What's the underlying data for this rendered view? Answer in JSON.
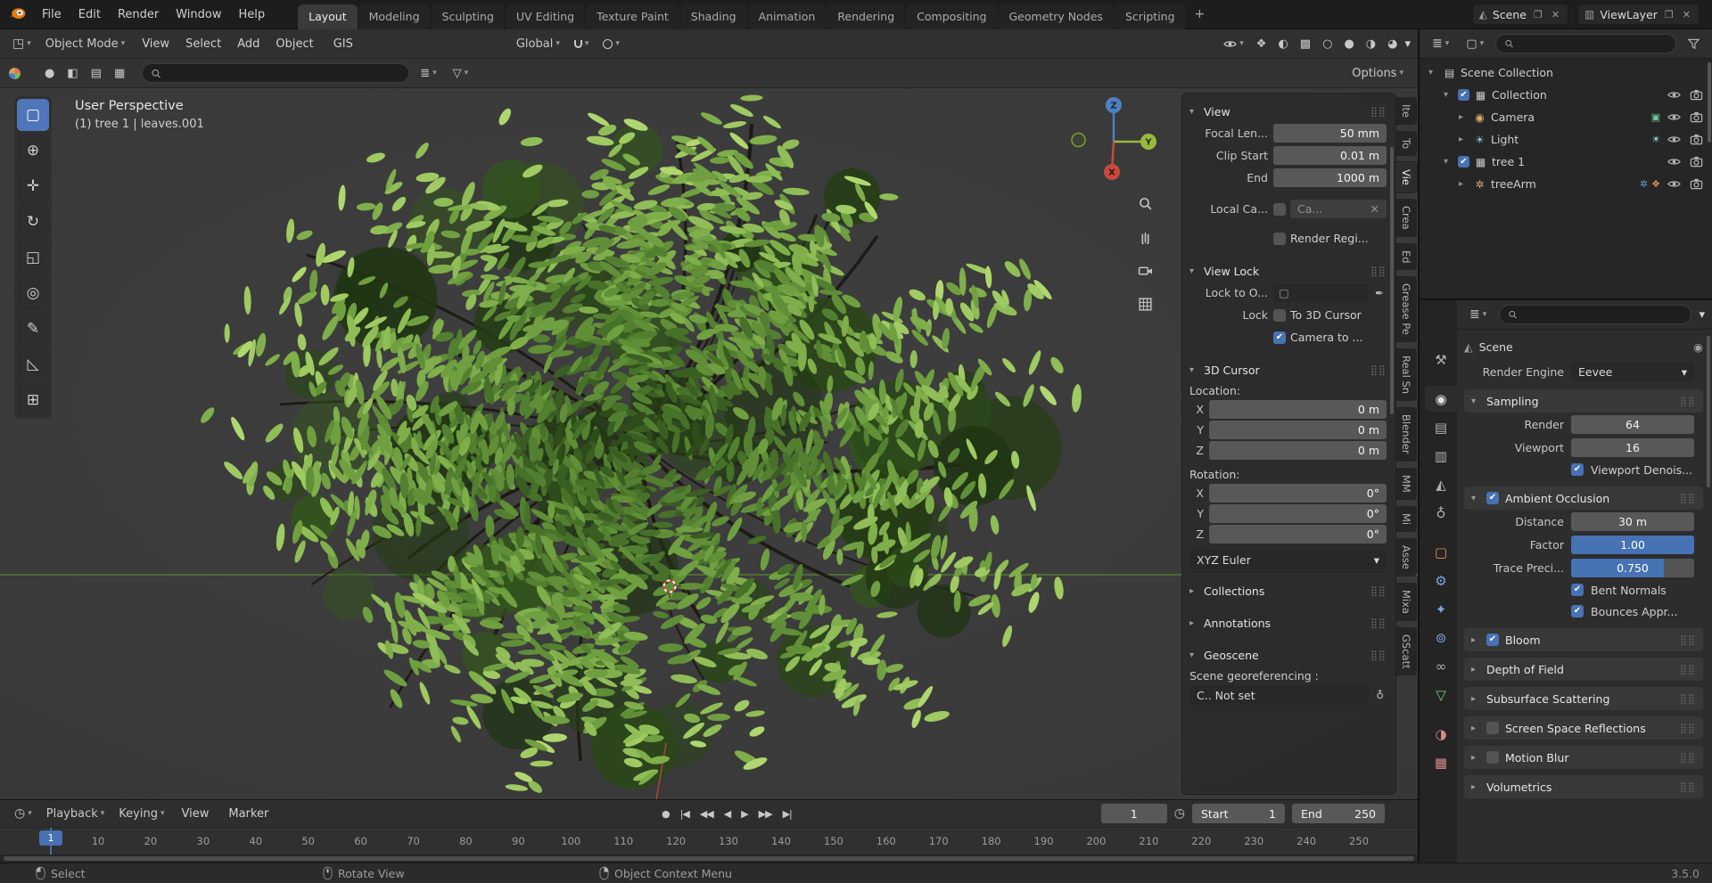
{
  "topbar": {
    "menus": [
      "File",
      "Edit",
      "Render",
      "Window",
      "Help"
    ],
    "workspaces": [
      {
        "label": "Layout",
        "active": true
      },
      {
        "label": "Modeling"
      },
      {
        "label": "Sculpting"
      },
      {
        "label": "UV Editing"
      },
      {
        "label": "Texture Paint"
      },
      {
        "label": "Shading"
      },
      {
        "label": "Animation"
      },
      {
        "label": "Rendering"
      },
      {
        "label": "Compositing"
      },
      {
        "label": "Geometry Nodes"
      },
      {
        "label": "Scripting"
      }
    ],
    "add_tab": "+",
    "scene_label": "Scene",
    "viewlayer_label": "ViewLayer",
    "scene_icon": "◭",
    "viewlayer_icon": "▥",
    "new_button": "❐",
    "unlink_button": "✕"
  },
  "viewport_header": {
    "editor_icon": "◳",
    "mode": "Object Mode",
    "menus": [
      "View",
      "Select",
      "Add",
      "Object"
    ],
    "gis_menu": "GIS",
    "orientation": "Global",
    "right_icons": [
      {
        "name": "show-gizmo",
        "glyph": "❖"
      },
      {
        "name": "overlays",
        "glyph": "◐"
      },
      {
        "name": "toggle-xray",
        "glyph": "▩"
      },
      {
        "name": "shading-wireframe",
        "glyph": "○"
      },
      {
        "name": "shading-solid",
        "glyph": "●"
      },
      {
        "name": "shading-material",
        "glyph": "◑",
        "active": true
      },
      {
        "name": "shading-rendered",
        "glyph": "◕"
      }
    ],
    "toolrow_icons": [
      {
        "name": "gradient-sphere"
      },
      {
        "name": "matcap-sphere",
        "glyph": "●"
      },
      {
        "name": "half-sphere",
        "glyph": "◧"
      },
      {
        "name": "plane",
        "glyph": "▤"
      },
      {
        "name": "grid",
        "glyph": "▦"
      }
    ],
    "options_label": "Options"
  },
  "tools": [
    {
      "name": "select-box",
      "glyph": "▢",
      "active": true
    },
    {
      "name": "cursor",
      "glyph": "⊕"
    },
    {
      "name": "move",
      "glyph": "✛"
    },
    {
      "name": "rotate",
      "glyph": "↻"
    },
    {
      "name": "scale",
      "glyph": "◱"
    },
    {
      "name": "transform",
      "glyph": "◎"
    },
    {
      "name": "annotate",
      "glyph": "✎"
    },
    {
      "name": "measure",
      "glyph": "◺"
    },
    {
      "name": "add-cube",
      "glyph": "⊞"
    }
  ],
  "viewport": {
    "perspective": "User Perspective",
    "active_object": "(1) tree 1 | leaves.001",
    "axis_x": "X",
    "axis_y": "Y",
    "axis_z": "Z",
    "colors": {
      "axis_x": "#c84a3f",
      "axis_y": "#9ab83d",
      "axis_z": "#4e7fc4"
    }
  },
  "npanel": {
    "tabs": [
      {
        "label": "Ite"
      },
      {
        "label": "To"
      },
      {
        "label": "Vie",
        "active": true
      },
      {
        "label": "Crea"
      },
      {
        "label": "Ed"
      },
      {
        "label": "Grease Pe"
      },
      {
        "label": "Real Sn"
      },
      {
        "label": "Blender"
      },
      {
        "label": "MM"
      },
      {
        "label": "Mi"
      },
      {
        "label": "Asse"
      },
      {
        "label": "Mixa"
      },
      {
        "label": "GScatt"
      }
    ],
    "view": {
      "title": "View",
      "focal_label": "Focal Len...",
      "focal_value": "50 mm",
      "clip_start_label": "Clip Start",
      "clip_start_value": "0.01 m",
      "clip_end_label": "End",
      "clip_end_value": "1000 m",
      "local_camera_label": "Local Ca...",
      "local_camera_value": "Ca...",
      "local_camera_checked": false,
      "clear_icon": "✕",
      "render_region_label": "Render Regi...",
      "render_region_checked": false
    },
    "view_lock": {
      "title": "View Lock",
      "lock_object_label": "Lock to O...",
      "lock_label": "Lock",
      "to_3d_cursor_label": "To 3D Cursor",
      "to_3d_cursor_checked": false,
      "camera_to_view_label": "Camera to ...",
      "camera_to_view_checked": true
    },
    "cursor": {
      "title": "3D Cursor",
      "location_label": "Location:",
      "rotation_label": "Rotation:",
      "location_rows": [
        {
          "axis": "X",
          "value": "0 m"
        },
        {
          "axis": "Y",
          "value": "0 m"
        },
        {
          "axis": "Z",
          "value": "0 m"
        }
      ],
      "rotation_rows": [
        {
          "axis": "X",
          "value": "0°"
        },
        {
          "axis": "Y",
          "value": "0°"
        },
        {
          "axis": "Z",
          "value": "0°"
        }
      ],
      "rotation_mode": "XYZ Euler"
    },
    "collections_title": "Collections",
    "annotations_title": "Annotations",
    "geoscene": {
      "title": "Geoscene",
      "georef_label": "Scene georeferencing :",
      "crs_value": "C.. Not set",
      "globe_icon": "♁"
    }
  },
  "outliner": {
    "rows": [
      {
        "label": "Scene Collection",
        "arrow": "▾",
        "glyph": "▤",
        "icon_color": "#c9c9c9",
        "depth": 0,
        "name": "scene-collection"
      },
      {
        "label": "Collection",
        "arrow": "▾",
        "glyph": "▦",
        "icon_color": "#c9c9c9",
        "depth": 1,
        "checkbox": true,
        "checked": true,
        "eye": true,
        "cam": true,
        "name": "collection"
      },
      {
        "label": "Camera",
        "arrow": "▸",
        "glyph": "◉",
        "icon_color": "#ddab72",
        "depth": 2,
        "badge": "▣",
        "badge_color": "#6ec49a",
        "eye": true,
        "cam": true,
        "name": "camera"
      },
      {
        "label": "Light",
        "arrow": "▸",
        "glyph": "☀",
        "icon_color": "#8fd0d0",
        "depth": 2,
        "badge": "☀",
        "badge_color": "#9adfe3",
        "eye": true,
        "cam": true,
        "name": "light"
      },
      {
        "label": "tree 1",
        "arrow": "▾",
        "glyph": "▦",
        "icon_color": "#c9c9c9",
        "depth": 1,
        "checkbox": true,
        "checked": true,
        "eye": true,
        "cam": true,
        "name": "tree-1"
      },
      {
        "label": "treeArm",
        "arrow": "▸",
        "glyph": "✲",
        "icon_color": "#ddab72",
        "depth": 2,
        "badge": "✲",
        "badge_color": "#5d9fd3",
        "badge2": "❖",
        "badge2_color": "#d9913f",
        "eye": true,
        "cam": true,
        "name": "tree-arm"
      }
    ]
  },
  "properties": {
    "tabs": [
      {
        "name": "tool",
        "glyph": "⚒",
        "color": "#b0b0b0"
      },
      {
        "name": "render",
        "glyph": "◉",
        "color": "#e0e0e0",
        "active": true,
        "gap": true
      },
      {
        "name": "output",
        "glyph": "▤",
        "color": "#b0b0b0"
      },
      {
        "name": "view-layer",
        "glyph": "▥",
        "color": "#b0b0b0"
      },
      {
        "name": "scene",
        "glyph": "◭",
        "color": "#b0b0b0"
      },
      {
        "name": "world",
        "glyph": "♁",
        "color": "#b0b0b0"
      },
      {
        "name": "object",
        "glyph": "▢",
        "color": "#e09458",
        "gap": true
      },
      {
        "name": "modifiers",
        "glyph": "⚙",
        "color": "#7aa5d8"
      },
      {
        "name": "particles",
        "glyph": "✦",
        "color": "#7aa5d8"
      },
      {
        "name": "physics",
        "glyph": "⊚",
        "color": "#7aa5d8"
      },
      {
        "name": "constraints",
        "glyph": "∞",
        "color": "#b0b0b0"
      },
      {
        "name": "object-data",
        "glyph": "▽",
        "color": "#7fc97f"
      },
      {
        "name": "material",
        "glyph": "◑",
        "color": "#d88a8a",
        "gap": true
      },
      {
        "name": "texture",
        "glyph": "▦",
        "color": "#d88a8a"
      }
    ],
    "scene_name": "Scene",
    "scene_icon": "◭",
    "render_engine_label": "Render Engine",
    "render_engine": "Eevee",
    "sampling": {
      "title": "Sampling",
      "render_label": "Render",
      "render_value": "64",
      "viewport_label": "Viewport",
      "viewport_value": "16",
      "denoise_label": "Viewport Denois...",
      "denoise_checked": true
    },
    "ao": {
      "title": "Ambient Occlusion",
      "checked": true,
      "distance_label": "Distance",
      "distance_value": "30 m",
      "factor_label": "Factor",
      "factor_value": "1.00",
      "trace_label": "Trace Preci...",
      "trace_value": "0.750",
      "bent_label": "Bent Normals",
      "bent_checked": true,
      "bounces_label": "Bounces Appr...",
      "bounces_checked": true
    },
    "collapsed": [
      {
        "label": "Bloom",
        "checkbox": true,
        "checked": true,
        "name": "bloom"
      },
      {
        "label": "Depth of Field",
        "name": "depth-of-field"
      },
      {
        "label": "Subsurface Scattering",
        "name": "subsurface-scattering"
      },
      {
        "label": "Screen Space Reflections",
        "checkbox": true,
        "checked": false,
        "name": "screen-space-reflections"
      },
      {
        "label": "Motion Blur",
        "checkbox": true,
        "checked": false,
        "name": "motion-blur"
      },
      {
        "label": "Volumetrics",
        "name": "volumetrics"
      }
    ]
  },
  "timeline": {
    "playback": "Playback",
    "keying": "Keying",
    "view": "View",
    "marker": "Marker",
    "transport": [
      {
        "name": "auto-key",
        "glyph": "●"
      },
      {
        "name": "jump-start",
        "glyph": "|◀"
      },
      {
        "name": "prev-keyframe",
        "glyph": "◀◀"
      },
      {
        "name": "play-reverse",
        "glyph": "◀"
      },
      {
        "name": "play",
        "glyph": "▶"
      },
      {
        "name": "next-keyframe",
        "glyph": "▶▶"
      },
      {
        "name": "jump-end",
        "glyph": "▶|"
      }
    ],
    "current_frame": "1",
    "start_label": "Start",
    "start_value": "1",
    "end_label": "End",
    "end_value": "250",
    "ticks": [
      10,
      20,
      30,
      40,
      50,
      60,
      70,
      80,
      90,
      100,
      110,
      120,
      130,
      140,
      150,
      160,
      170,
      180,
      190,
      200,
      210,
      220,
      230,
      240,
      250
    ]
  },
  "statusbar": {
    "select": "Select",
    "rotate": "Rotate View",
    "context": "Object Context Menu",
    "version": "3.5.0"
  }
}
